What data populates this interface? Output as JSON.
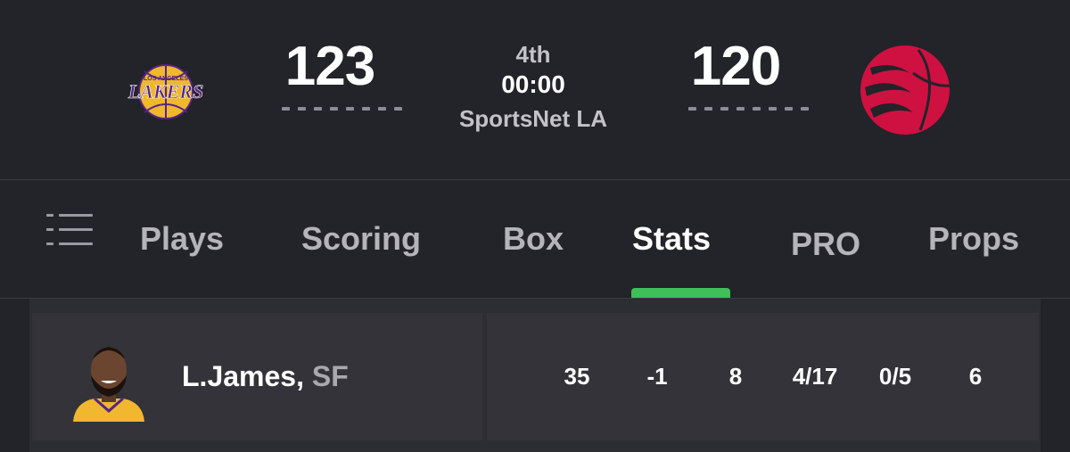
{
  "colors": {
    "background": "#23232a",
    "row_background": "#333339",
    "active_tab_indicator": "#3fbf5a",
    "lakers_purple": "#552583",
    "lakers_gold": "#f0b72f",
    "raptors_red": "#ce1141"
  },
  "game": {
    "home_team": {
      "logo_icon": "lakers-logo",
      "score": "123"
    },
    "away_team": {
      "logo_icon": "raptors-logo",
      "score": "120"
    },
    "period": "4th",
    "clock": "00:00",
    "network": "SportsNet LA"
  },
  "nav": {
    "menu_icon": "list-icon",
    "tabs": [
      {
        "label": "Plays",
        "active": false
      },
      {
        "label": "Scoring",
        "active": false
      },
      {
        "label": "Box",
        "active": false
      },
      {
        "label": "Stats",
        "active": true
      },
      {
        "label": "PRO",
        "active": false
      },
      {
        "label": "Props",
        "active": false
      }
    ]
  },
  "player_row": {
    "avatar_icon": "player-headshot",
    "name": "L.James,",
    "position": "SF",
    "stats": [
      "35",
      "-1",
      "8",
      "4/17",
      "0/5",
      "6"
    ]
  }
}
